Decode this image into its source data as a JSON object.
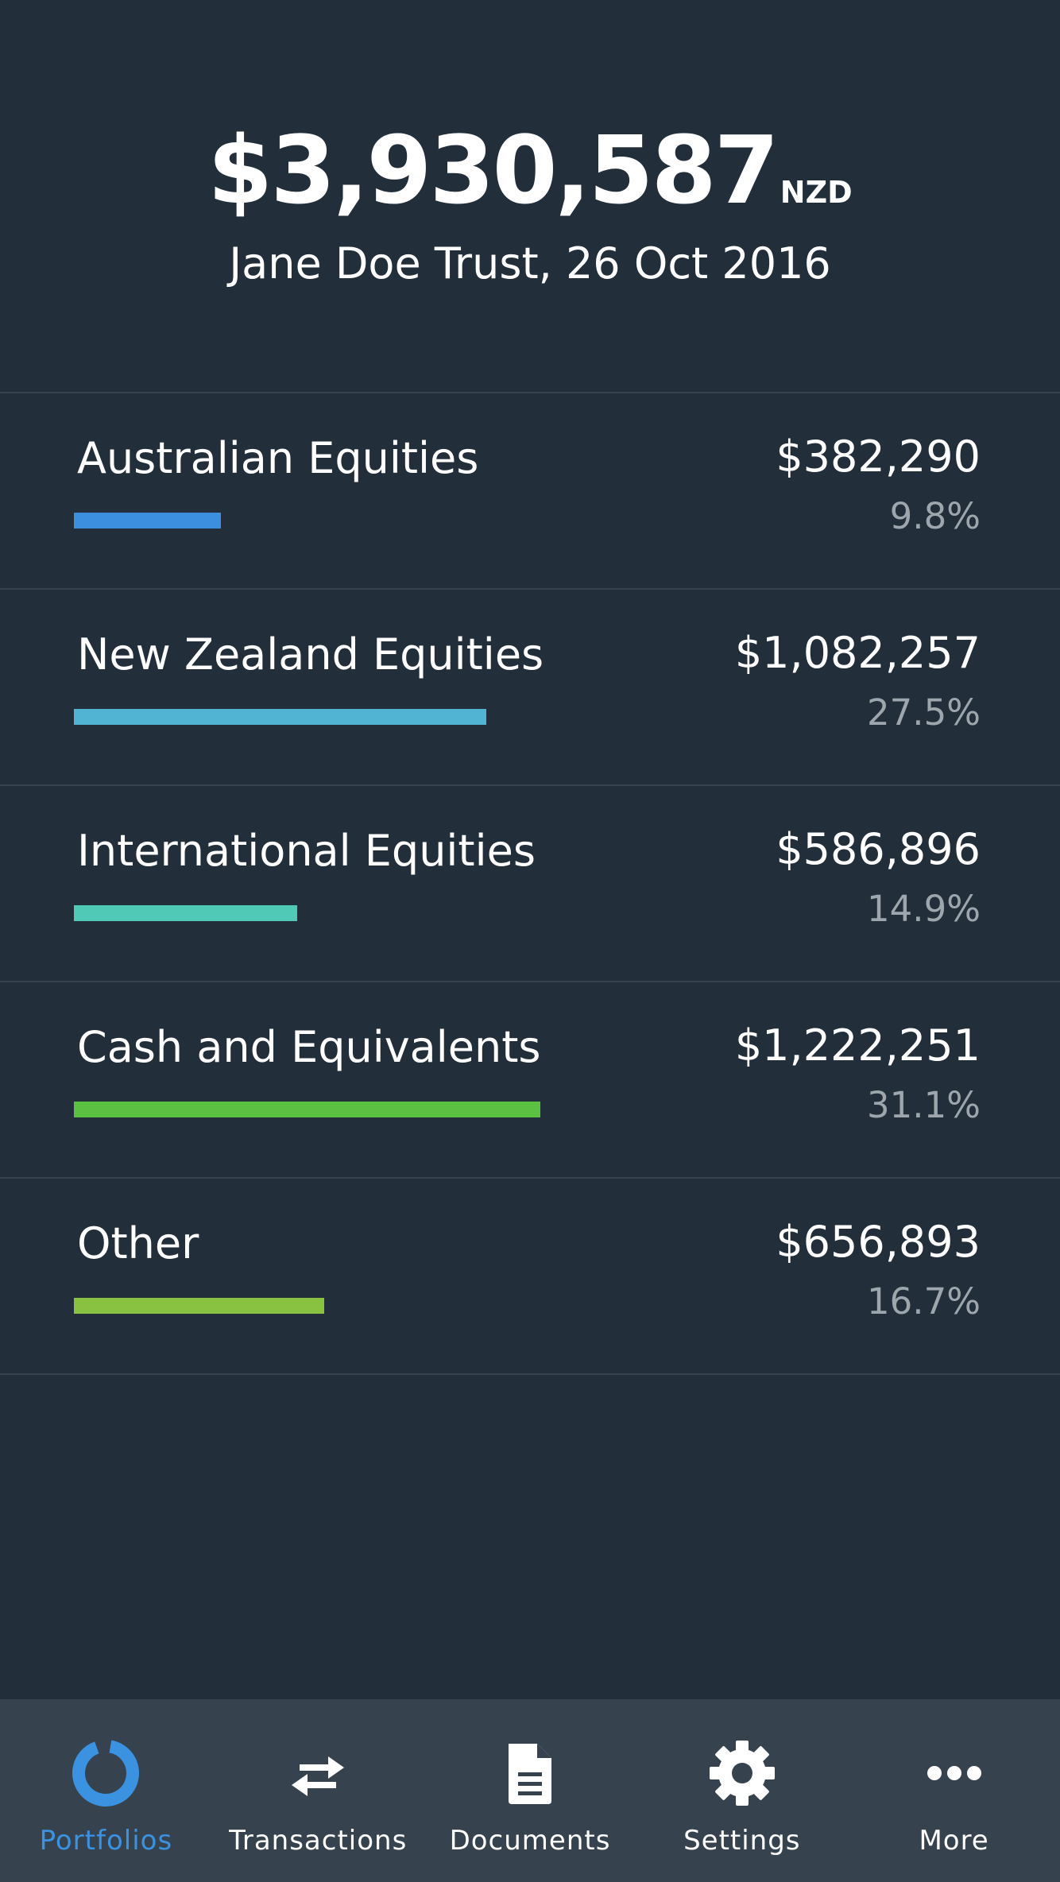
{
  "header": {
    "total_amount": "$3,930,587",
    "currency": "NZD",
    "subtitle": "Jane Doe Trust, 26 Oct 2016"
  },
  "allocations": [
    {
      "label": "Australian Equities",
      "value": "$382,290",
      "percent": "9.8%",
      "bar_fraction": 0.098,
      "color": "#3b8fde"
    },
    {
      "label": "New Zealand Equities",
      "value": "$1,082,257",
      "percent": "27.5%",
      "bar_fraction": 0.275,
      "color": "#52b4d3"
    },
    {
      "label": "International Equities",
      "value": "$586,896",
      "percent": "14.9%",
      "bar_fraction": 0.149,
      "color": "#50c9b6"
    },
    {
      "label": "Cash and Equivalents",
      "value": "$1,222,251",
      "percent": "31.1%",
      "bar_fraction": 0.311,
      "color": "#5cc143"
    },
    {
      "label": "Other",
      "value": "$656,893",
      "percent": "16.7%",
      "bar_fraction": 0.167,
      "color": "#88c240"
    }
  ],
  "tabbar": {
    "active_color": "#3a92e0",
    "inactive_color": "#ffffff",
    "tabs": [
      {
        "label": "Portfolios",
        "icon": "donut-chart-icon",
        "active": true
      },
      {
        "label": "Transactions",
        "icon": "transfer-arrows-icon",
        "active": false
      },
      {
        "label": "Documents",
        "icon": "document-icon",
        "active": false
      },
      {
        "label": "Settings",
        "icon": "gear-icon",
        "active": false
      },
      {
        "label": "More",
        "icon": "ellipsis-icon",
        "active": false
      }
    ]
  }
}
